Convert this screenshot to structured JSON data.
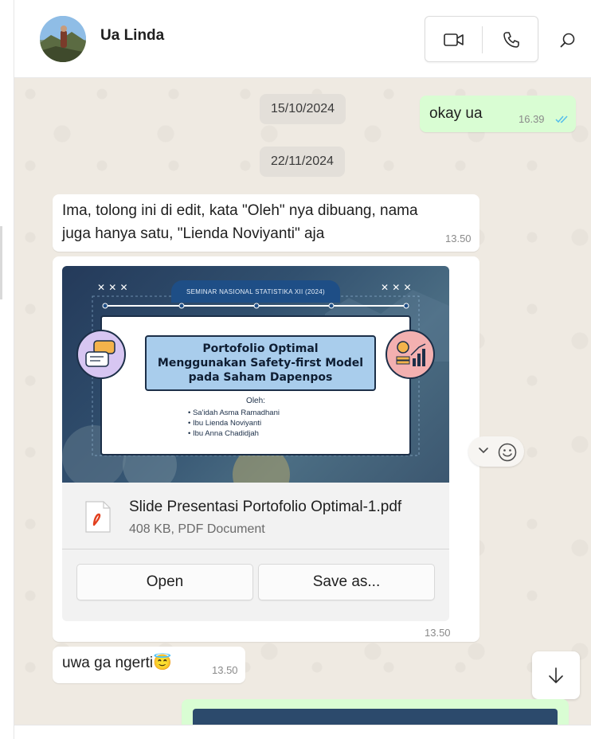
{
  "header": {
    "contact_name": "Ua Linda"
  },
  "dates": [
    "15/10/2024",
    "22/11/2024"
  ],
  "messages": {
    "m1": {
      "text": "okay ua",
      "time": "16.39"
    },
    "m2": {
      "line1": "Ima, tolong ini di edit, kata \"Oleh\" nya dibuang, nama",
      "line2": "juga hanya satu, \"Lienda Noviyanti\" aja",
      "time": "13.50"
    },
    "m3": {
      "file_name": "Slide Presentasi Portofolio Optimal-1.pdf",
      "file_meta": "408 KB, PDF Document",
      "open_label": "Open",
      "save_label": "Save as...",
      "time": "13.50",
      "slide": {
        "tab": "SEMINAR NASIONAL STATISTIKA XII (2024)",
        "title_lines": [
          "Portofolio Optimal",
          "Menggunakan Safety-first Model",
          "pada Saham Dapenpos"
        ],
        "by": "Oleh:",
        "names": [
          "• Sa'idah Asma Ramadhani",
          "• Ibu Lienda Noviyanti",
          "• Ibu Anna Chadidjah"
        ]
      }
    },
    "m4": {
      "text": "uwa ga ngerti😇",
      "time": "13.50"
    }
  },
  "icons": {
    "video": "video-camera-icon",
    "phone": "phone-icon",
    "search": "search-icon",
    "read": "double-check-icon",
    "scroll": "arrow-down-icon"
  },
  "colors": {
    "outgoing_bubble": "#d9fdd3",
    "incoming_bubble": "#ffffff",
    "chat_bg": "#efeae2",
    "read_tick": "#53bdeb"
  }
}
